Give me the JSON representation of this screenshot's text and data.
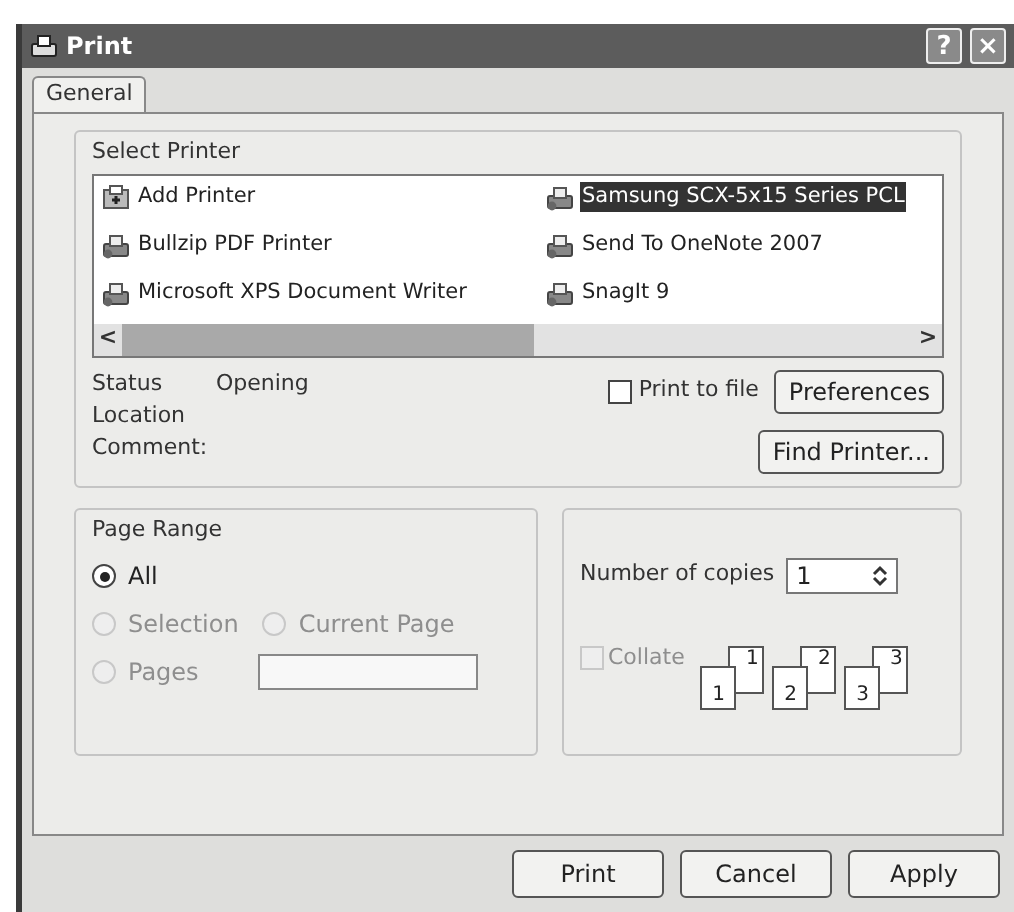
{
  "window": {
    "title": "Print",
    "title_buttons": [
      "?",
      "×"
    ]
  },
  "tabs": [
    {
      "label": "General",
      "selected": true
    }
  ],
  "select_printer": {
    "title": "Select Printer",
    "printers": [
      {
        "name": "Add Printer",
        "kind": "add",
        "selected": false
      },
      {
        "name": "Bullzip PDF Printer",
        "kind": "printer",
        "selected": false
      },
      {
        "name": "Microsoft XPS Document Writer",
        "kind": "printer",
        "selected": false
      },
      {
        "name": "Samsung SCX-5x15 Series PCL",
        "kind": "printer",
        "selected": true
      },
      {
        "name": "Send To OneNote 2007",
        "kind": "printer",
        "selected": false
      },
      {
        "name": "SnagIt 9",
        "kind": "printer",
        "selected": false
      }
    ],
    "scroll_left": "<",
    "scroll_right": ">",
    "info": [
      {
        "label": "Status",
        "value": "Opening"
      },
      {
        "label": "Location"
      },
      {
        "label": "Comment:"
      }
    ],
    "print_to_file": {
      "label": "Print to file",
      "checked": false
    },
    "preferences_button": "Preferences",
    "find_printer_button": "Find Printer..."
  },
  "page_range": {
    "title": "Page Range",
    "options": [
      {
        "label": "All",
        "selected": true,
        "disabled": false
      },
      {
        "label": "Selection",
        "selected": false,
        "disabled": true
      },
      {
        "label": "Current Page",
        "selected": false,
        "disabled": true
      },
      {
        "label": "Pages",
        "selected": false,
        "disabled": true
      }
    ]
  },
  "copies": {
    "label": "Number of copies",
    "value": "1",
    "collate": {
      "label": "Collate",
      "checked": false,
      "disabled": true
    },
    "collate_pages": [
      "1",
      "1",
      "2",
      "2",
      "3",
      "3"
    ]
  },
  "buttons": [
    "Print",
    "Cancel",
    "Apply"
  ]
}
